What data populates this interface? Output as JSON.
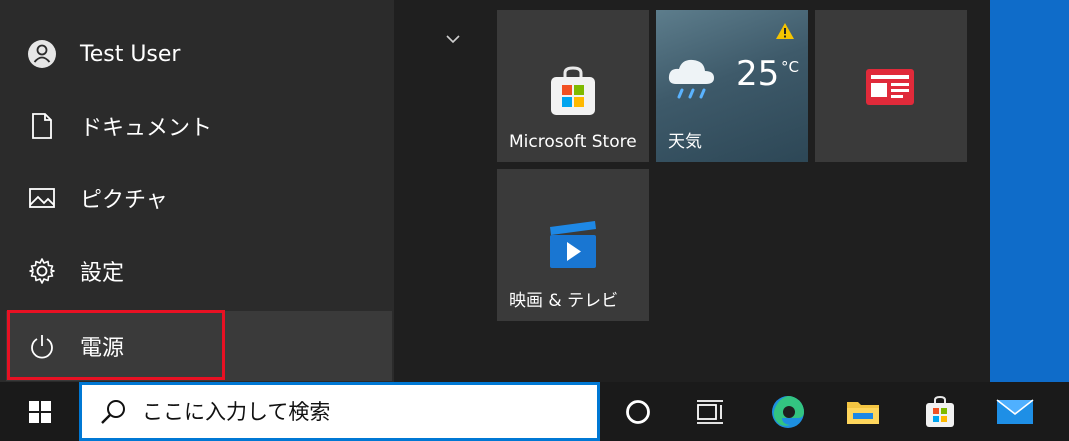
{
  "start_menu": {
    "user": {
      "name": "Test User"
    },
    "rail": {
      "documents_label": "ドキュメント",
      "pictures_label": "ピクチャ",
      "settings_label": "設定",
      "power_label": "電源"
    },
    "tiles": {
      "store_label": "Microsoft Store",
      "weather_label": "天気",
      "weather_temp": "25",
      "weather_unit": "°C",
      "movies_label": "映画 & テレビ"
    }
  },
  "taskbar": {
    "search_placeholder": "ここに入力して検索"
  },
  "colors": {
    "accent": "#0078d4",
    "highlight": "#e81123",
    "desktop_blue": "#0f6cc9"
  }
}
